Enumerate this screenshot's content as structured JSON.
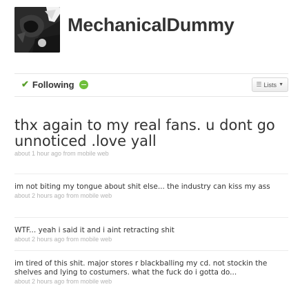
{
  "profile": {
    "screen_name": "MechanicalDummy"
  },
  "actions": {
    "following_label": "Following",
    "lists_label": "Lists"
  },
  "tweets": [
    {
      "text": "thx again to my real fans. u dont go unnoticed .love yall",
      "time": "about 1 hour ago",
      "from": "from",
      "source": "mobile web"
    },
    {
      "text": "im not biting my tongue about shit else... the industry can kiss my ass",
      "time": "about 2 hours ago",
      "from": "from",
      "source": "mobile web"
    },
    {
      "text": "WTF... yeah i said it and i aint retracting shit",
      "time": "about 2 hours ago",
      "from": "from",
      "source": "mobile web"
    },
    {
      "text": "im tired of this shit. major stores r blackballing my cd. not stockin the shelves and lying to costumers. what the fuck do i gotta do...",
      "time": "about 2 hours ago",
      "from": "from",
      "source": "mobile web"
    }
  ]
}
